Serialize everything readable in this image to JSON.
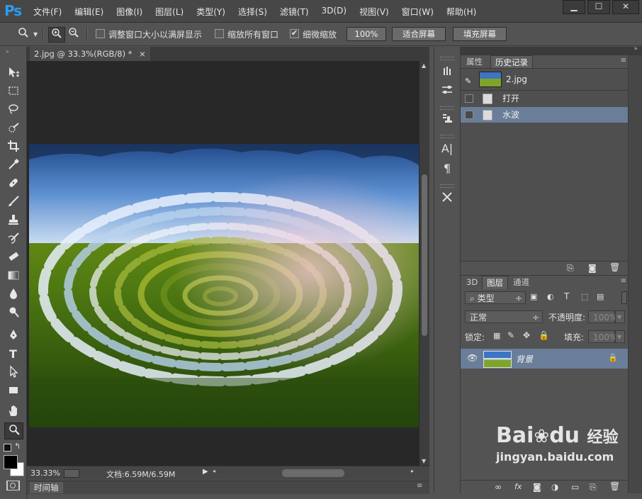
{
  "app": {
    "logo": "Ps"
  },
  "menu": [
    "文件(F)",
    "编辑(E)",
    "图像(I)",
    "图层(L)",
    "类型(Y)",
    "选择(S)",
    "滤镜(T)",
    "3D(D)",
    "视图(V)",
    "窗口(W)",
    "帮助(H)"
  ],
  "window_controls": {
    "minimize": "▁",
    "maximize": "☐",
    "close": "✕"
  },
  "options": {
    "resize_windows_label": "调整窗口大小以满屏显示",
    "resize_windows_checked": false,
    "zoom_all_label": "缩放所有窗口",
    "zoom_all_checked": false,
    "scrubby_zoom_label": "细微缩放",
    "scrubby_zoom_checked": true,
    "zoom_100_button": "100%",
    "fit_screen_button": "适合屏幕",
    "fill_screen_button": "填充屏幕"
  },
  "document": {
    "tab_title": "2.jpg @ 33.3%(RGB/8) *",
    "tab_close": "×"
  },
  "status": {
    "zoom": "33.33%",
    "doc_size": "文档:6.59M/6.59M"
  },
  "timeline": {
    "label": "时间轴"
  },
  "history_panel": {
    "tabs": [
      "属性",
      "历史记录"
    ],
    "active_tab": "历史记录",
    "snapshot_name": "2.jpg",
    "states": [
      {
        "label": "打开",
        "selected": false
      },
      {
        "label": "水波",
        "selected": true
      }
    ]
  },
  "layers_panel": {
    "tabs": [
      "3D",
      "图层",
      "通道"
    ],
    "active_tab": "图层",
    "filter_kind": "类型",
    "blend_mode": "正常",
    "opacity_label": "不透明度:",
    "opacity_value": "100%",
    "lock_label": "锁定:",
    "fill_label": "填充:",
    "fill_value": "100%",
    "layers": [
      {
        "name": "背景",
        "visible": true,
        "locked": true
      }
    ]
  },
  "watermark": {
    "brand_a": "Bai",
    "brand_b": "du",
    "brand_cn": "经验",
    "url": "jingyan.baidu.com"
  },
  "colors": {
    "selection": "#6a7e99",
    "ps_blue": "#2d9bf0",
    "panel_bg": "#535353",
    "canvas_bg": "#282828"
  }
}
